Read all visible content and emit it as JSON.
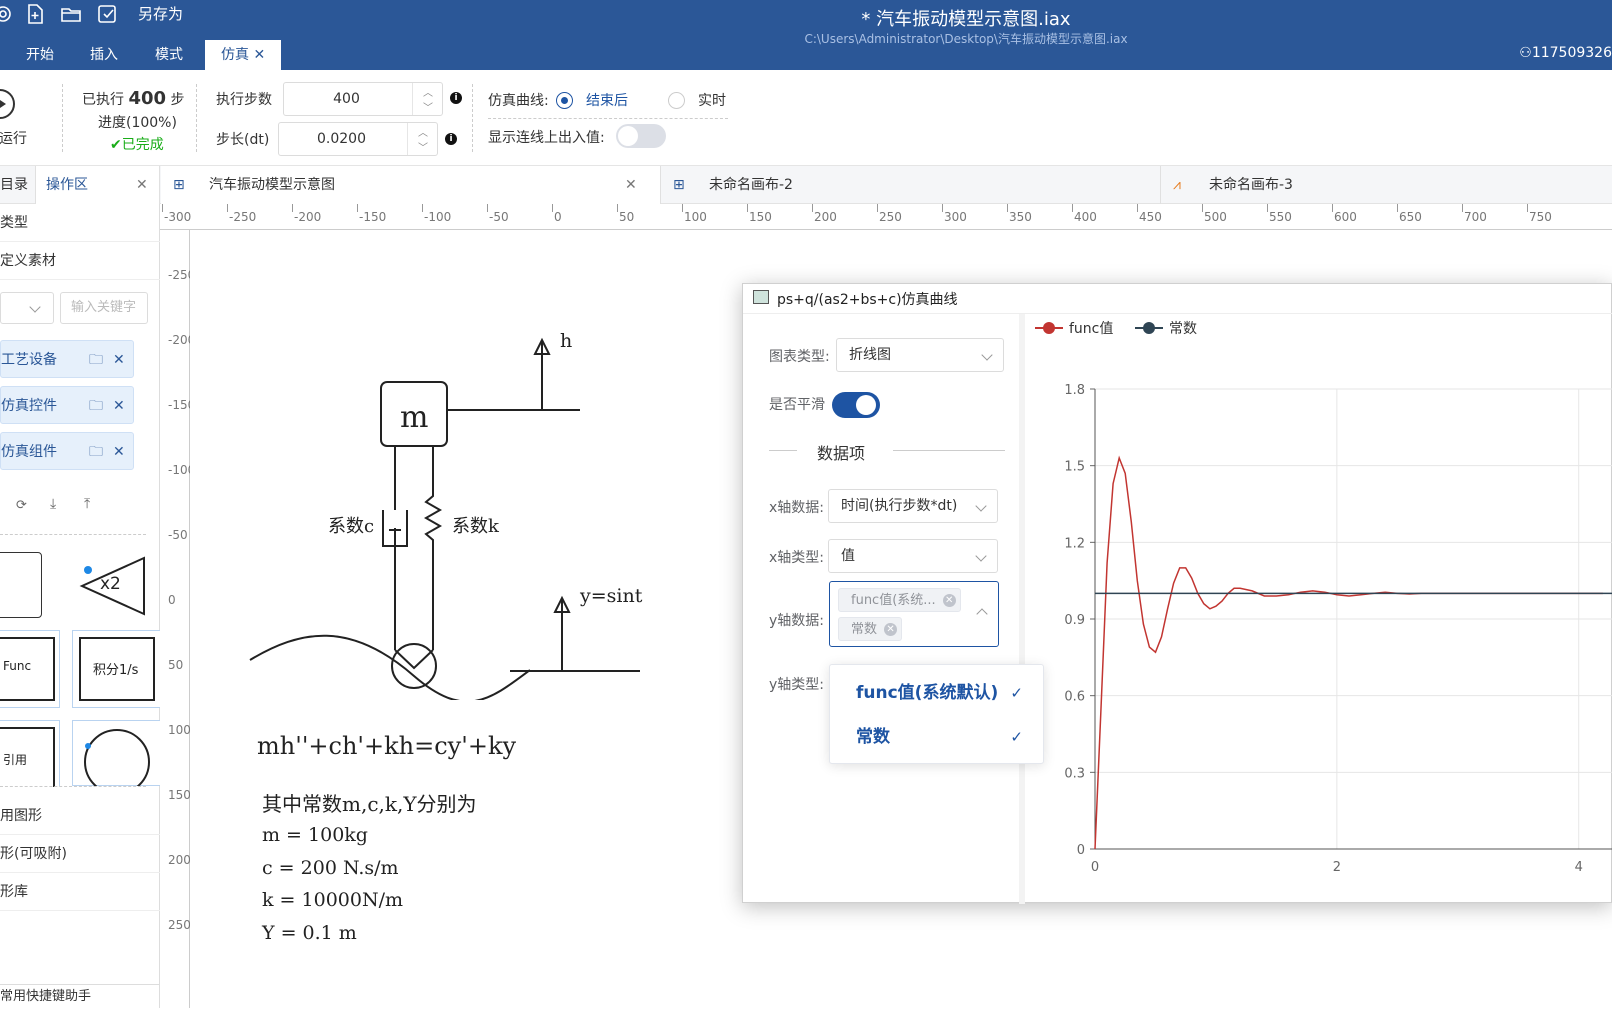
{
  "titlebar": {
    "save_as": "另存为",
    "title": "*  汽车振动模型示意图.iax",
    "path": "C:\\Users\\Administrator\\Desktop\\汽车振动模型示意图.iax",
    "user": "117509326"
  },
  "menu": [
    "开始",
    "插入",
    "模式",
    "仿真"
  ],
  "toolbar": {
    "run_label": "运行",
    "executed_prefix": "已执行",
    "executed_count": "400",
    "executed_suffix": "步",
    "progress": "进度(100%)",
    "status": "已完成",
    "steps_label": "执行步数",
    "steps_value": "400",
    "dt_label": "步长(dt)",
    "dt_value": "0.0200",
    "curve_label": "仿真曲线:",
    "curve_opt1": "结束后",
    "curve_opt2": "实时",
    "show_io_label": "显示连线上出入值:"
  },
  "left_panel": {
    "tab_catalog": "目录",
    "tab_workspace": "操作区",
    "type_label": "类型",
    "custom_material": "定义素材",
    "search_placeholder": "输入关键字",
    "libs": [
      "工艺设备",
      "仿真控件",
      "仿真组件"
    ],
    "shape_x2": "x2",
    "shape_func": "Func",
    "shape_integral": "积分1/s",
    "shape_ref": "引用",
    "bottom_rows": [
      "用图形",
      "形(可吸附)",
      "形库"
    ],
    "shortcut": "常用快捷键助手"
  },
  "tabs": [
    "汽车振动模型示意图",
    "未命名画布-2",
    "未命名画布-3"
  ],
  "ruler_h": [
    "-300",
    "-250",
    "-200",
    "-150",
    "-100",
    "-50",
    "0",
    "50",
    "100",
    "150",
    "200",
    "250",
    "300",
    "350",
    "400",
    "450",
    "500",
    "550",
    "600",
    "650",
    "700",
    "750"
  ],
  "ruler_v": [
    "-250",
    "-200",
    "-150",
    "-100",
    "-50",
    "0",
    "50",
    "100",
    "150",
    "200",
    "250"
  ],
  "diagram": {
    "mass": "m",
    "h_label": "h",
    "damper_label": "系数c",
    "spring_label": "系数k",
    "y_label": "y=sint",
    "equation": "mh''+ch'+kh=cy'+ky",
    "note_title": "其中常数m,c,k,Y分别为",
    "note_lines": [
      "m = 100kg",
      "c = 200 N.s/m",
      "k = 10000N/m",
      "Y = 0.1 m"
    ]
  },
  "dialog": {
    "title": "ps+q/(as2+bs+c)仿真曲线",
    "chart_type_label": "图表类型:",
    "chart_type_value": "折线图",
    "smooth_label": "是否平滑",
    "section": "数据项",
    "x_data_label": "x轴数据:",
    "x_data_value": "时间(执行步数*dt)",
    "x_type_label": "x轴类型:",
    "x_type_value": "值",
    "y_data_label": "y轴数据:",
    "y_chips": [
      "func值(系统...",
      "常数"
    ],
    "y_type_label": "y轴类型:",
    "dropdown": [
      "func值(系统默认)",
      "常数"
    ]
  },
  "colors": {
    "accent": "#2b5797",
    "func": "#c23531",
    "const": "#2f4554"
  },
  "chart_data": {
    "type": "line",
    "legend_position": "top-left",
    "grid": true,
    "xlim": [
      0,
      4.3
    ],
    "ylim": [
      0,
      1.8
    ],
    "x_ticks": [
      "0",
      "2",
      "4"
    ],
    "y_ticks": [
      "0",
      "0.3",
      "0.6",
      "0.9",
      "1.2",
      "1.5",
      "1.8"
    ],
    "series": [
      {
        "name": "func值",
        "color": "#c23531",
        "x": [
          0,
          0.05,
          0.1,
          0.15,
          0.2,
          0.25,
          0.3,
          0.35,
          0.4,
          0.45,
          0.5,
          0.55,
          0.6,
          0.65,
          0.7,
          0.75,
          0.8,
          0.85,
          0.9,
          0.95,
          1.0,
          1.05,
          1.1,
          1.15,
          1.2,
          1.3,
          1.4,
          1.5,
          1.6,
          1.7,
          1.8,
          1.9,
          2.0,
          2.1,
          2.2,
          2.3,
          2.4,
          2.5,
          2.6,
          2.7,
          2.8,
          2.9,
          3.0,
          3.2,
          3.4,
          3.6,
          3.8,
          4.0,
          4.2
        ],
        "values": [
          0,
          0.55,
          1.12,
          1.43,
          1.53,
          1.47,
          1.28,
          1.05,
          0.88,
          0.79,
          0.77,
          0.83,
          0.94,
          1.04,
          1.1,
          1.1,
          1.06,
          1.0,
          0.96,
          0.94,
          0.95,
          0.97,
          1.0,
          1.02,
          1.02,
          1.01,
          0.99,
          0.99,
          0.995,
          1.005,
          1.01,
          1.005,
          0.995,
          0.99,
          0.995,
          1.0,
          1.005,
          1.0,
          0.998,
          1.0,
          1.0,
          1.0,
          1.0,
          1.0,
          1.0,
          1.0,
          1.0,
          1.0,
          1.0
        ]
      },
      {
        "name": "常数",
        "color": "#2f4554",
        "x": [
          0,
          4.3
        ],
        "values": [
          1.0,
          1.0
        ]
      }
    ]
  }
}
